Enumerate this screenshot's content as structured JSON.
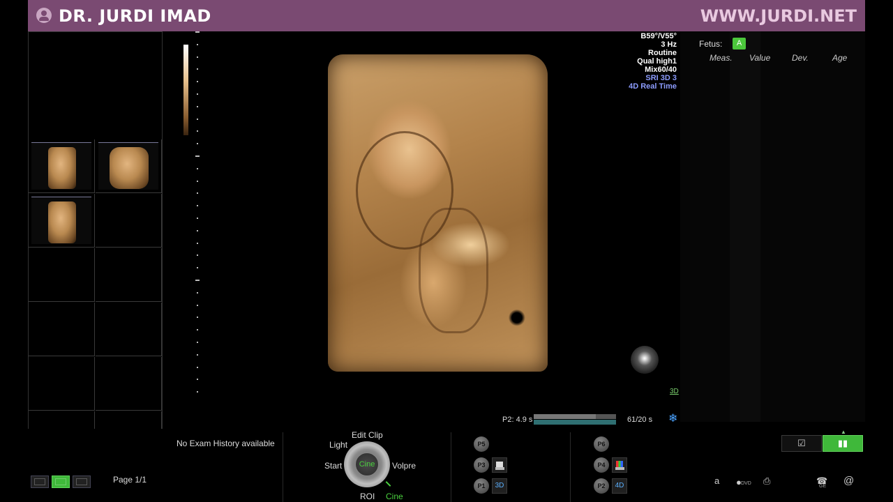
{
  "banner": {
    "doctor_name": "DR. JURDI IMAD",
    "website": "WWW.JURDI.NET",
    "color": "#7a4a72"
  },
  "params": {
    "angles": "B59°/V55°",
    "rate": "3 Hz",
    "quality_preset": "Routine",
    "quality": "Qual high1",
    "mix": "Mix60/40",
    "sri": "SRI 3D 3",
    "mode": "4D Real Time"
  },
  "worksheet": {
    "fetus_label": "Fetus:",
    "fetus_value": "A",
    "columns": [
      "Meas.",
      "Value",
      "Dev.",
      "Age"
    ]
  },
  "viewport": {
    "badge": "3D",
    "cine_prefix": "P2:",
    "cine_time": "4.9 s",
    "cine_progress": 0.75,
    "frames": "61/20 s"
  },
  "bottom": {
    "exam_history": "No Exam History available",
    "page": "Page 1/1",
    "dial": {
      "top": "Edit Clip",
      "left_upper": "Light",
      "left": "Start",
      "right": "Volpre",
      "center": "Cine",
      "bottom": "ROI",
      "bottom_right": "Cine"
    },
    "p_buttons": [
      "P5",
      "P3",
      "P1",
      "P6",
      "P4",
      "P2"
    ],
    "mode_buttons": [
      "3D",
      "4D"
    ],
    "sys_icons": {
      "a": "a",
      "dvd": "DVD",
      "ge": "GE",
      "at": "@"
    }
  }
}
